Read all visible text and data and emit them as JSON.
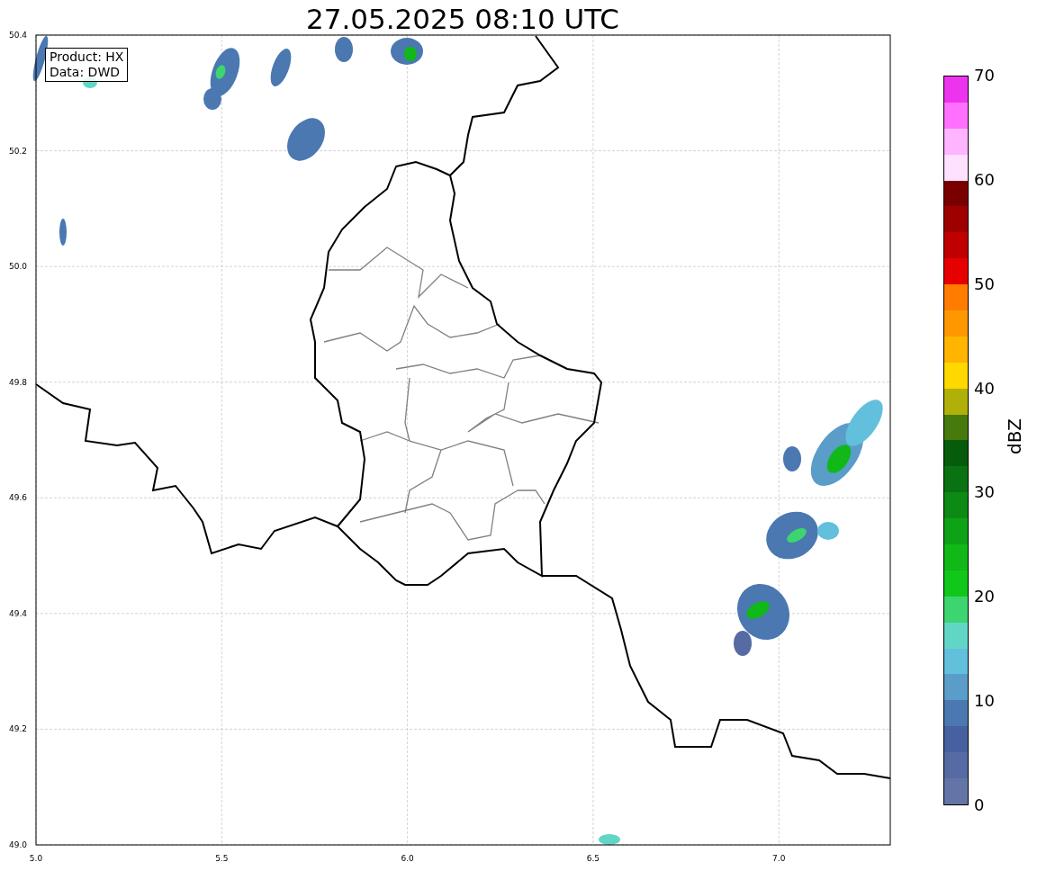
{
  "title": "27.05.2025 08:10 UTC",
  "info_box": [
    "Product: HX",
    "Data: DWD"
  ],
  "x_ticks": [
    "5.0",
    "5.5",
    "6.0",
    "6.5",
    "7.0"
  ],
  "y_ticks": [
    "50.4",
    "50.2",
    "50.0",
    "49.8",
    "49.6",
    "49.4",
    "49.2",
    "49.0"
  ],
  "colorbar": {
    "label": "dBZ",
    "ticks": [
      "70",
      "60",
      "50",
      "40",
      "30",
      "20",
      "10",
      "0"
    ],
    "colors": [
      {
        "color": "#6474a6"
      },
      {
        "color": "#566aa3"
      },
      {
        "color": "#4760a0"
      },
      {
        "color": "#4b78b0"
      },
      {
        "color": "#5a9dc8"
      },
      {
        "color": "#62c0dd"
      },
      {
        "color": "#62d6c6"
      },
      {
        "color": "#3dd56f"
      },
      {
        "color": "#10c81a"
      },
      {
        "color": "#10b818"
      },
      {
        "color": "#0ea216"
      },
      {
        "color": "#0c8a14"
      },
      {
        "color": "#0a7212"
      },
      {
        "color": "#075c0c"
      },
      {
        "color": "#477a0c"
      },
      {
        "color": "#b0b008"
      },
      {
        "color": "#ffd800"
      },
      {
        "color": "#ffb400"
      },
      {
        "color": "#ff9800"
      },
      {
        "color": "#ff7c00"
      },
      {
        "color": "#e60000"
      },
      {
        "color": "#c00000"
      },
      {
        "color": "#9e0000"
      },
      {
        "color": "#7a0000"
      },
      {
        "color": "#ffe0ff"
      },
      {
        "color": "#ffb4ff"
      },
      {
        "color": "#ff70ff"
      },
      {
        "color": "#ee33ee"
      }
    ]
  }
}
